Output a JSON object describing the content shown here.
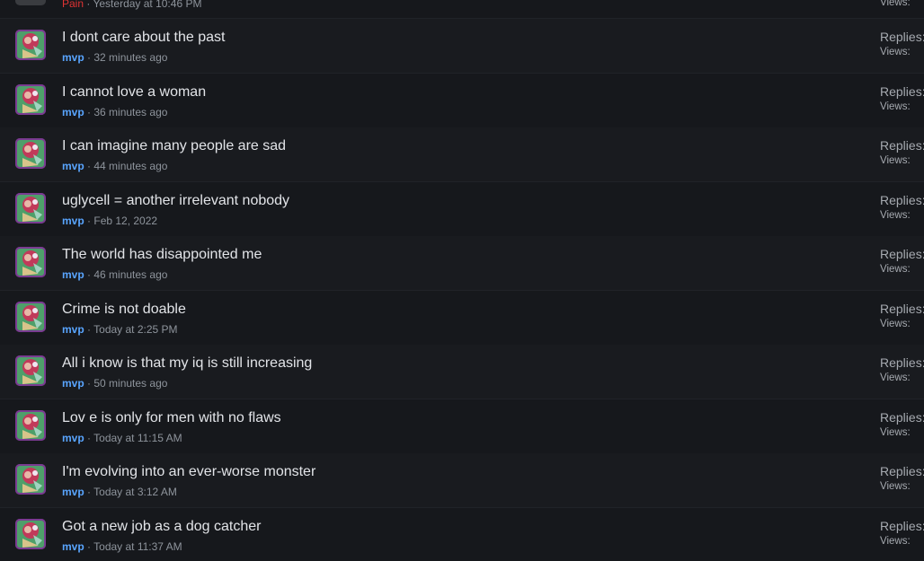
{
  "partial_thread": {
    "author": "Pain",
    "time": "Yesterday at 10:46 PM",
    "views_label": "Views:"
  },
  "labels": {
    "separator": " · ",
    "replies_label": "Replies:",
    "views_label": "Views:"
  },
  "threads": [
    {
      "title": "I dont care about the past",
      "author": "mvp",
      "time": "32 minutes ago"
    },
    {
      "title": "I cannot love a woman",
      "author": "mvp",
      "time": "36 minutes ago"
    },
    {
      "title": "I can imagine many people are sad",
      "author": "mvp",
      "time": "44 minutes ago"
    },
    {
      "title": "uglycell = another irrelevant nobody",
      "author": "mvp",
      "time": "Feb 12, 2022"
    },
    {
      "title": "The world has disappointed me",
      "author": "mvp",
      "time": "46 minutes ago"
    },
    {
      "title": "Crime is not doable",
      "author": "mvp",
      "time": "Today at 2:25 PM"
    },
    {
      "title": "All i know is that my iq is still increasing",
      "author": "mvp",
      "time": "50 minutes ago"
    },
    {
      "title": "Lov e is only for men with no flaws",
      "author": "mvp",
      "time": "Today at 11:15 AM"
    },
    {
      "title": "I'm evolving into an ever-worse monster",
      "author": "mvp",
      "time": "Today at 3:12 AM"
    },
    {
      "title": "Got a new job as a dog catcher",
      "author": "mvp",
      "time": "Today at 11:37 AM"
    }
  ]
}
